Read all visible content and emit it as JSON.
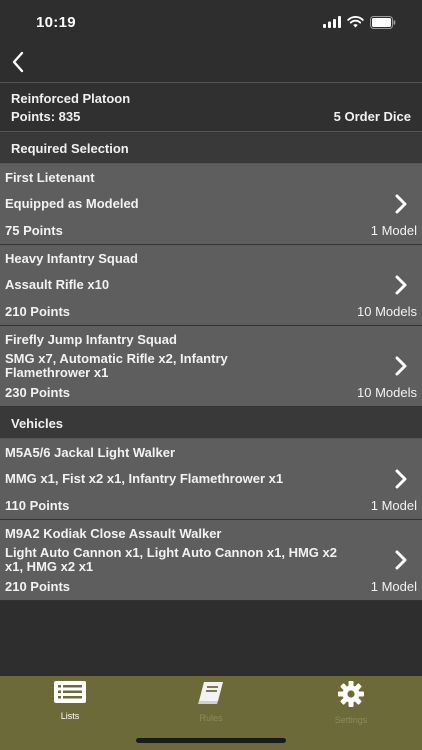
{
  "status": {
    "time": "10:19"
  },
  "summary": {
    "title": "Reinforced Platoon",
    "points": "Points: 835",
    "order_dice": "5 Order Dice"
  },
  "sections": {
    "required": "Required Selection",
    "vehicles": "Vehicles"
  },
  "units": [
    {
      "name": "First Lietenant",
      "equipment": "Equipped as Modeled",
      "points": "75 Points",
      "models": "1 Model"
    },
    {
      "name": "Heavy Infantry Squad",
      "equipment": "Assault Rifle x10",
      "points": "210 Points",
      "models": "10 Models"
    },
    {
      "name": "Firefly Jump Infantry Squad",
      "equipment": "SMG x7, Automatic Rifle x2, Infantry Flamethrower x1",
      "points": "230 Points",
      "models": "10 Models"
    },
    {
      "name": "M5A5/6 Jackal Light Walker",
      "equipment": "MMG x1, Fist x2 x1, Infantry Flamethrower x1",
      "points": "110 Points",
      "models": "1 Model"
    },
    {
      "name": "M9A2 Kodiak Close Assault Walker",
      "equipment": "Light Auto Cannon x1, Light Auto Cannon x1, HMG x2 x1, HMG x2 x1",
      "points": "210 Points",
      "models": "1 Model"
    }
  ],
  "tabs": [
    {
      "label": "Lists",
      "icon": "list-icon",
      "active": true
    },
    {
      "label": "Rules",
      "icon": "book-icon",
      "active": false
    },
    {
      "label": "Settings",
      "icon": "gear-icon",
      "active": false
    }
  ],
  "colors": {
    "background": "#2e2e2e",
    "row": "#5e5e5e",
    "tab_bar": "#6d6a3a"
  }
}
